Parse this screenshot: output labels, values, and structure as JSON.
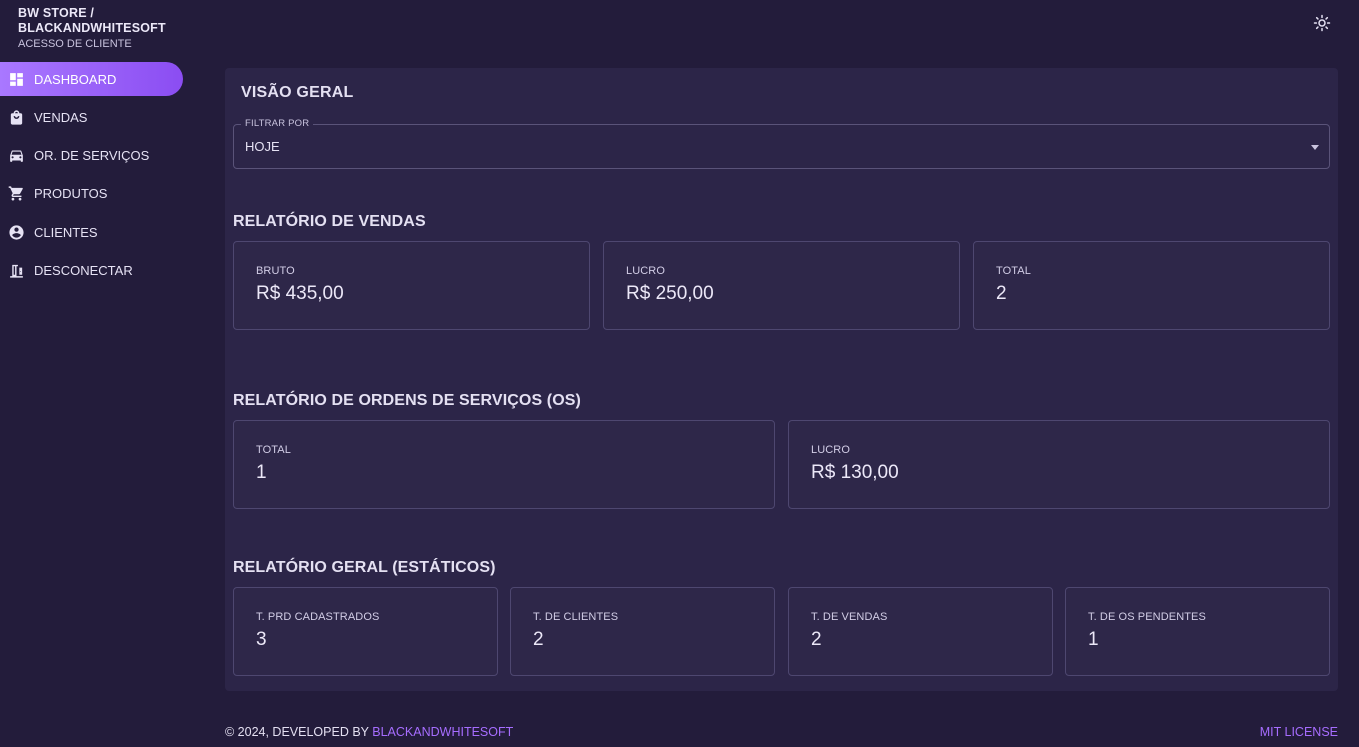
{
  "brand": {
    "title": "BW STORE / BLACKANDWHITESOFT",
    "subtitle": "ACESSO DE CLIENTE"
  },
  "colors": {
    "accent": "#9a5cff",
    "background": "#231c3b",
    "panel": "#2c2548"
  },
  "sidebar": {
    "items": [
      {
        "label": "DASHBOARD",
        "icon": "dashboard-icon",
        "active": true
      },
      {
        "label": "VENDAS",
        "icon": "shopping-bag-icon"
      },
      {
        "label": "OR. DE SERVIÇOS",
        "icon": "car-icon"
      },
      {
        "label": "PRODUTOS",
        "icon": "cart-icon"
      },
      {
        "label": "CLIENTES",
        "icon": "account-circle-icon"
      },
      {
        "label": "DESCONECTAR",
        "icon": "door-exit-icon"
      }
    ]
  },
  "header": {
    "theme_toggle_icon": "brightness-icon"
  },
  "main": {
    "title": "VISÃO GERAL",
    "filter": {
      "label": "FILTRAR POR",
      "value": "HOJE"
    },
    "sales_report": {
      "title": "RELATÓRIO DE VENDAS",
      "cards": [
        {
          "label": "BRUTO",
          "value": "R$ 435,00"
        },
        {
          "label": "LUCRO",
          "value": "R$ 250,00"
        },
        {
          "label": "TOTAL",
          "value": "2"
        }
      ]
    },
    "service_orders_report": {
      "title": "RELATÓRIO DE ORDENS DE SERVIÇOS (OS)",
      "cards": [
        {
          "label": "TOTAL",
          "value": "1"
        },
        {
          "label": "LUCRO",
          "value": "R$ 130,00"
        }
      ]
    },
    "general_report": {
      "title": "RELATÓRIO GERAL (ESTÁTICOS)",
      "cards": [
        {
          "label": "T. PRD CADASTRADOS",
          "value": "3"
        },
        {
          "label": "T. DE CLIENTES",
          "value": "2"
        },
        {
          "label": "T. DE VENDAS",
          "value": "2"
        },
        {
          "label": "T. DE OS PENDENTES",
          "value": "1"
        }
      ]
    }
  },
  "footer": {
    "prefix": "© 2024, DEVELOPED BY",
    "link": "BLACKANDWHITESOFT",
    "license": "MIT LICENSE"
  }
}
